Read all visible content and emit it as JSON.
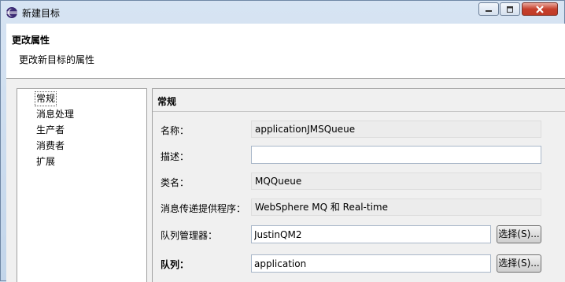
{
  "window": {
    "title": "新建目标",
    "icon": "eclipse-icon"
  },
  "banner": {
    "title": "更改属性",
    "description": "更改新目标的属性"
  },
  "nav": {
    "items": [
      {
        "label": "常规",
        "selected": true
      },
      {
        "label": "消息处理",
        "selected": false
      },
      {
        "label": "生产者",
        "selected": false
      },
      {
        "label": "消费者",
        "selected": false
      },
      {
        "label": "扩展",
        "selected": false
      }
    ]
  },
  "content": {
    "section_title": "常规",
    "fields": {
      "name": {
        "label": "名称：",
        "value": "applicationJMSQueue"
      },
      "description": {
        "label": "描述：",
        "value": ""
      },
      "class_name": {
        "label": "类名：",
        "value": "MQQueue"
      },
      "provider": {
        "label": "消息传递提供程序：",
        "value": "WebSphere MQ 和 Real-time"
      },
      "queue_manager": {
        "label": "队列管理器：",
        "value": "JustinQM2",
        "button": "选择(S)..."
      },
      "queue": {
        "label": "队列：",
        "value": "application",
        "button": "选择(S)..."
      }
    }
  },
  "colors": {
    "frame": "#c9d9ec",
    "close_button": "#c6402d",
    "panel_bg": "#f0f0f0"
  }
}
